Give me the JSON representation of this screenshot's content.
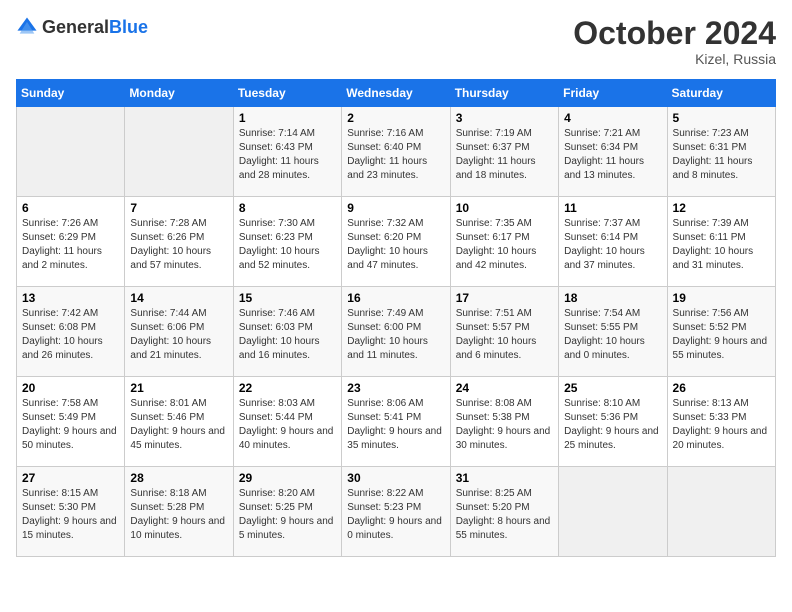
{
  "header": {
    "logo_general": "General",
    "logo_blue": "Blue",
    "month": "October 2024",
    "location": "Kizel, Russia"
  },
  "days_of_week": [
    "Sunday",
    "Monday",
    "Tuesday",
    "Wednesday",
    "Thursday",
    "Friday",
    "Saturday"
  ],
  "weeks": [
    [
      {
        "day": "",
        "detail": ""
      },
      {
        "day": "",
        "detail": ""
      },
      {
        "day": "1",
        "detail": "Sunrise: 7:14 AM\nSunset: 6:43 PM\nDaylight: 11 hours and 28 minutes."
      },
      {
        "day": "2",
        "detail": "Sunrise: 7:16 AM\nSunset: 6:40 PM\nDaylight: 11 hours and 23 minutes."
      },
      {
        "day": "3",
        "detail": "Sunrise: 7:19 AM\nSunset: 6:37 PM\nDaylight: 11 hours and 18 minutes."
      },
      {
        "day": "4",
        "detail": "Sunrise: 7:21 AM\nSunset: 6:34 PM\nDaylight: 11 hours and 13 minutes."
      },
      {
        "day": "5",
        "detail": "Sunrise: 7:23 AM\nSunset: 6:31 PM\nDaylight: 11 hours and 8 minutes."
      }
    ],
    [
      {
        "day": "6",
        "detail": "Sunrise: 7:26 AM\nSunset: 6:29 PM\nDaylight: 11 hours and 2 minutes."
      },
      {
        "day": "7",
        "detail": "Sunrise: 7:28 AM\nSunset: 6:26 PM\nDaylight: 10 hours and 57 minutes."
      },
      {
        "day": "8",
        "detail": "Sunrise: 7:30 AM\nSunset: 6:23 PM\nDaylight: 10 hours and 52 minutes."
      },
      {
        "day": "9",
        "detail": "Sunrise: 7:32 AM\nSunset: 6:20 PM\nDaylight: 10 hours and 47 minutes."
      },
      {
        "day": "10",
        "detail": "Sunrise: 7:35 AM\nSunset: 6:17 PM\nDaylight: 10 hours and 42 minutes."
      },
      {
        "day": "11",
        "detail": "Sunrise: 7:37 AM\nSunset: 6:14 PM\nDaylight: 10 hours and 37 minutes."
      },
      {
        "day": "12",
        "detail": "Sunrise: 7:39 AM\nSunset: 6:11 PM\nDaylight: 10 hours and 31 minutes."
      }
    ],
    [
      {
        "day": "13",
        "detail": "Sunrise: 7:42 AM\nSunset: 6:08 PM\nDaylight: 10 hours and 26 minutes."
      },
      {
        "day": "14",
        "detail": "Sunrise: 7:44 AM\nSunset: 6:06 PM\nDaylight: 10 hours and 21 minutes."
      },
      {
        "day": "15",
        "detail": "Sunrise: 7:46 AM\nSunset: 6:03 PM\nDaylight: 10 hours and 16 minutes."
      },
      {
        "day": "16",
        "detail": "Sunrise: 7:49 AM\nSunset: 6:00 PM\nDaylight: 10 hours and 11 minutes."
      },
      {
        "day": "17",
        "detail": "Sunrise: 7:51 AM\nSunset: 5:57 PM\nDaylight: 10 hours and 6 minutes."
      },
      {
        "day": "18",
        "detail": "Sunrise: 7:54 AM\nSunset: 5:55 PM\nDaylight: 10 hours and 0 minutes."
      },
      {
        "day": "19",
        "detail": "Sunrise: 7:56 AM\nSunset: 5:52 PM\nDaylight: 9 hours and 55 minutes."
      }
    ],
    [
      {
        "day": "20",
        "detail": "Sunrise: 7:58 AM\nSunset: 5:49 PM\nDaylight: 9 hours and 50 minutes."
      },
      {
        "day": "21",
        "detail": "Sunrise: 8:01 AM\nSunset: 5:46 PM\nDaylight: 9 hours and 45 minutes."
      },
      {
        "day": "22",
        "detail": "Sunrise: 8:03 AM\nSunset: 5:44 PM\nDaylight: 9 hours and 40 minutes."
      },
      {
        "day": "23",
        "detail": "Sunrise: 8:06 AM\nSunset: 5:41 PM\nDaylight: 9 hours and 35 minutes."
      },
      {
        "day": "24",
        "detail": "Sunrise: 8:08 AM\nSunset: 5:38 PM\nDaylight: 9 hours and 30 minutes."
      },
      {
        "day": "25",
        "detail": "Sunrise: 8:10 AM\nSunset: 5:36 PM\nDaylight: 9 hours and 25 minutes."
      },
      {
        "day": "26",
        "detail": "Sunrise: 8:13 AM\nSunset: 5:33 PM\nDaylight: 9 hours and 20 minutes."
      }
    ],
    [
      {
        "day": "27",
        "detail": "Sunrise: 8:15 AM\nSunset: 5:30 PM\nDaylight: 9 hours and 15 minutes."
      },
      {
        "day": "28",
        "detail": "Sunrise: 8:18 AM\nSunset: 5:28 PM\nDaylight: 9 hours and 10 minutes."
      },
      {
        "day": "29",
        "detail": "Sunrise: 8:20 AM\nSunset: 5:25 PM\nDaylight: 9 hours and 5 minutes."
      },
      {
        "day": "30",
        "detail": "Sunrise: 8:22 AM\nSunset: 5:23 PM\nDaylight: 9 hours and 0 minutes."
      },
      {
        "day": "31",
        "detail": "Sunrise: 8:25 AM\nSunset: 5:20 PM\nDaylight: 8 hours and 55 minutes."
      },
      {
        "day": "",
        "detail": ""
      },
      {
        "day": "",
        "detail": ""
      }
    ]
  ]
}
